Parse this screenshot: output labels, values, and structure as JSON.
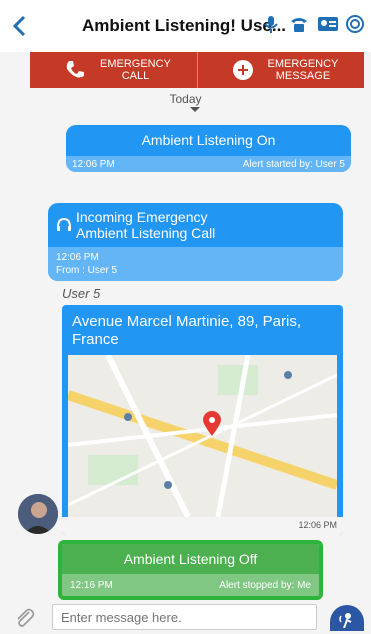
{
  "header": {
    "back_icon": "back-chevron-icon",
    "title": "Ambient Listening! Use...",
    "icons": [
      "mic-icon",
      "phone-icon",
      "contact-card-icon",
      "refresh-icon"
    ]
  },
  "emergency": {
    "call_label": "EMERGENCY\nCALL",
    "message_label": "EMERGENCY\nMESSAGE"
  },
  "chat": {
    "date_separator": "Today",
    "messages": [
      {
        "text": "Ambient Listening On",
        "time": "12:06 PM",
        "meta": "Alert started by: User 5"
      },
      {
        "line1": "Incoming Emergency",
        "line2": "Ambient Listening Call",
        "time": "12:06 PM",
        "from": "From : User 5"
      },
      {
        "sender": "User 5",
        "address": "Avenue Marcel Martinie, 89, Paris, France",
        "time": "12:06 PM"
      },
      {
        "text": "Ambient Listening Off",
        "time": "12:16 PM",
        "meta": "Alert stopped by: Me"
      }
    ]
  },
  "composer": {
    "placeholder": "Enter message here."
  },
  "colors": {
    "accent": "#2196f3",
    "emergency": "#c43a26",
    "success": "#4caf50"
  }
}
